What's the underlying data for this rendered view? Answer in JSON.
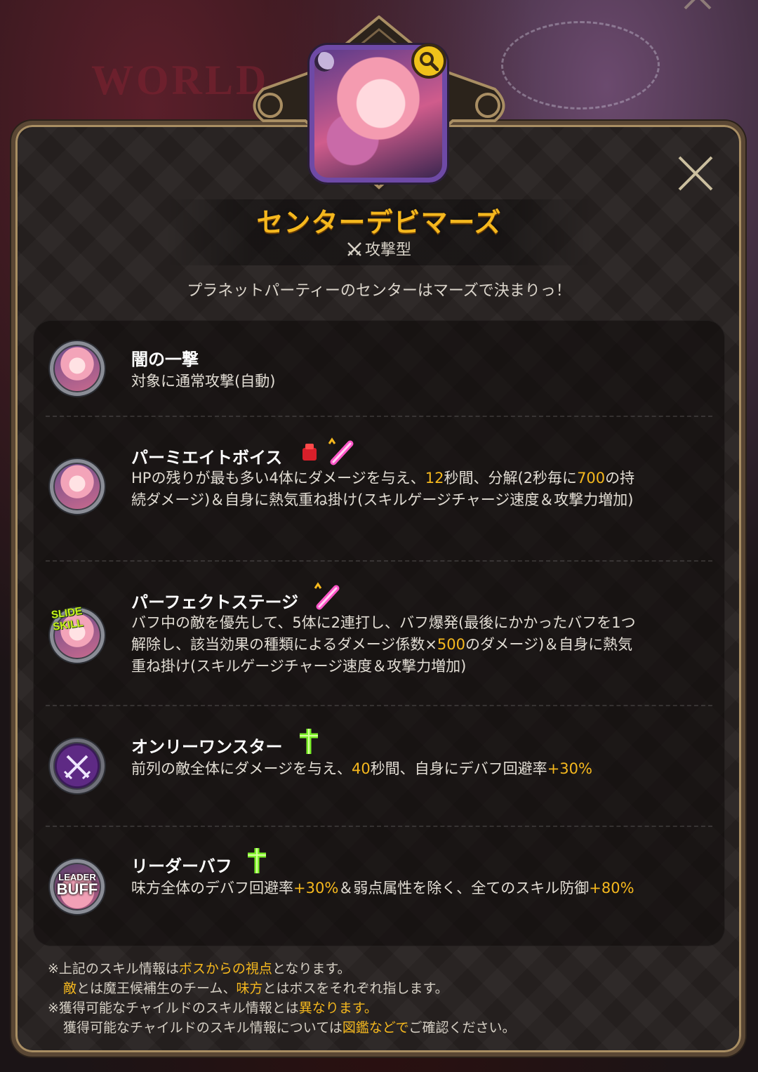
{
  "header": {
    "title": "センターデビマーズ",
    "type_label": "攻撃型",
    "tagline": "プラネットパーティーのセンターはマーズで決まりっ！",
    "background_logo": "WORLD"
  },
  "skills": [
    {
      "name": "闇の一撃",
      "desc": [
        {
          "t": "対象に通常攻撃(自動)"
        }
      ]
    },
    {
      "name": "パーミエイトボイス",
      "desc": [
        {
          "t": "HPの残りが最も多い4体にダメージを与え、"
        },
        {
          "t": "12",
          "hl": true
        },
        {
          "t": "秒間、分解(2秒毎に"
        },
        {
          "t": "700",
          "hl": true
        },
        {
          "t": "の持続ダメージ)＆自身に熱気重ね掛け(スキルゲージチャージ速度＆攻撃力増加)"
        }
      ]
    },
    {
      "name": "パーフェクトステージ",
      "badge": "SLIDE SKILL",
      "desc": [
        {
          "t": "バフ中の敵を優先して、5体に2連打し、バフ爆発(最後にかかったバフを1つ解除し、該当効果の種類によるダメージ係数×"
        },
        {
          "t": "500",
          "hl": true
        },
        {
          "t": "のダメージ)＆自身に熱気重ね掛け(スキルゲージチャージ速度＆攻撃力増加)"
        }
      ]
    },
    {
      "name": "オンリーワンスター",
      "desc": [
        {
          "t": "前列の敵全体にダメージを与え、"
        },
        {
          "t": "40",
          "hl": true
        },
        {
          "t": "秒間、自身にデバフ回避率"
        },
        {
          "t": "+30%",
          "hl": true
        }
      ]
    },
    {
      "name": "リーダーバフ",
      "icon_text": [
        "LEADER",
        "BUFF"
      ],
      "desc": [
        {
          "t": "味方全体のデバフ回避率"
        },
        {
          "t": "+30%",
          "hl": true
        },
        {
          "t": "＆弱点属性を除く、全てのスキル防御"
        },
        {
          "t": "+80%",
          "hl": true
        }
      ]
    }
  ],
  "notes": [
    [
      {
        "t": "※上記のスキル情報は"
      },
      {
        "t": "ボスからの視点",
        "hl": true
      },
      {
        "t": "となります。"
      }
    ],
    [
      {
        "t": "敵",
        "hl": true
      },
      {
        "t": "とは魔王候補生のチーム、"
      },
      {
        "t": "味方",
        "hl": true
      },
      {
        "t": "とはボスをそれぞれ指します。"
      }
    ],
    [
      {
        "t": "※獲得可能なチャイルドのスキル情報とは"
      },
      {
        "t": "異なります。",
        "hl": true
      }
    ],
    [
      {
        "t": "獲得可能なチャイルドのスキル情報については"
      },
      {
        "t": "図鑑などで",
        "hl": true
      },
      {
        "t": "ご確認ください。"
      }
    ]
  ],
  "colors": {
    "accent": "#f5b81e",
    "frame": "#a98e63",
    "portrait_border": "#6e4aa6"
  },
  "icons": [
    "search-icon",
    "close-icon",
    "swords-icon",
    "red-gem-icon",
    "pink-stick-icon",
    "green-cross-icon",
    "crossed-swords-icon"
  ]
}
